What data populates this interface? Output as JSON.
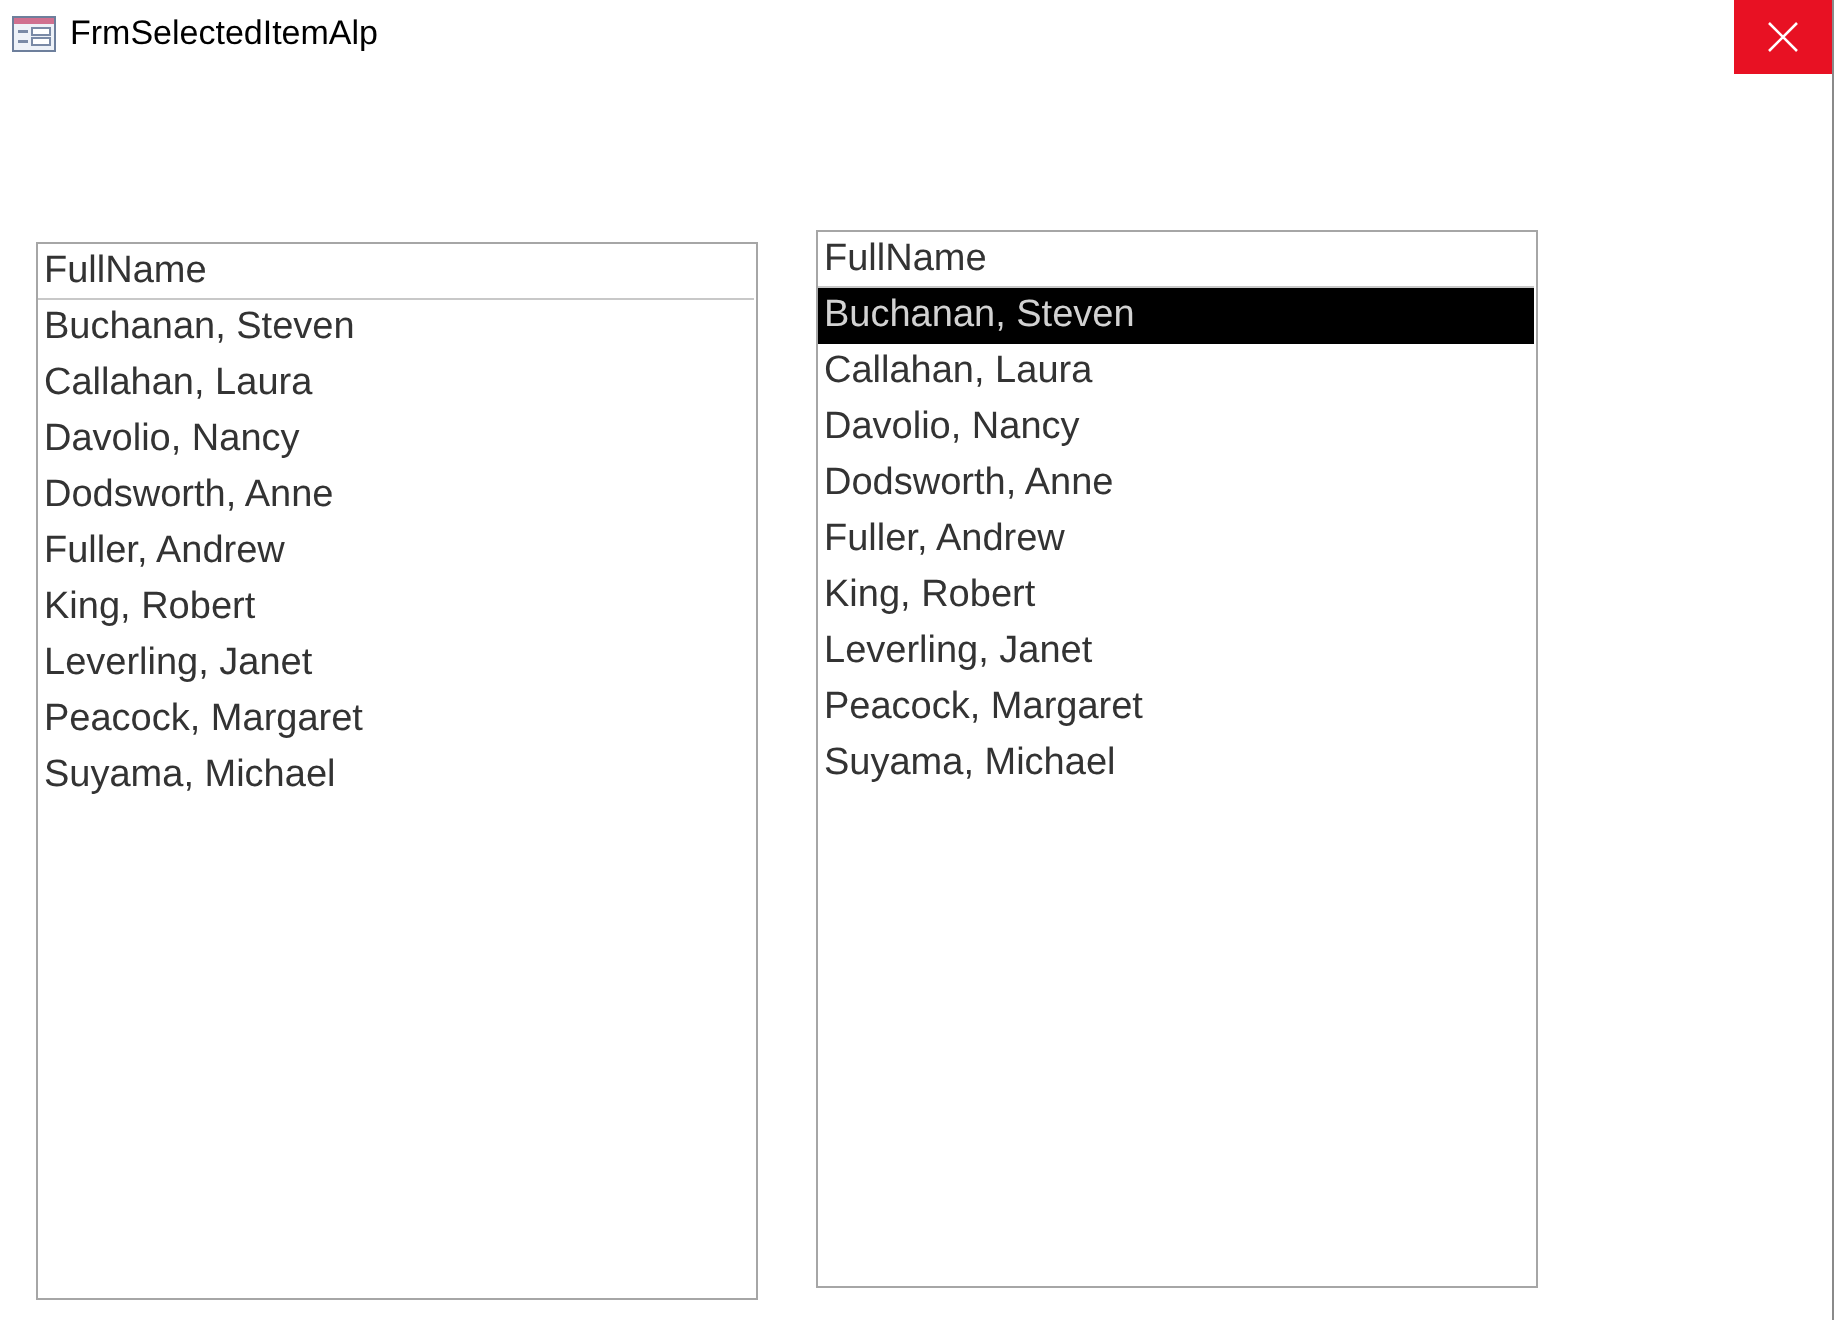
{
  "window": {
    "title": "FrmSelectedItemAlp"
  },
  "lists": [
    {
      "header": "FullName",
      "items": [
        {
          "label": "Buchanan, Steven",
          "selected": false
        },
        {
          "label": "Callahan, Laura",
          "selected": false
        },
        {
          "label": "Davolio, Nancy",
          "selected": false
        },
        {
          "label": "Dodsworth, Anne",
          "selected": false
        },
        {
          "label": "Fuller, Andrew",
          "selected": false
        },
        {
          "label": "King, Robert",
          "selected": false
        },
        {
          "label": "Leverling, Janet",
          "selected": false
        },
        {
          "label": "Peacock, Margaret",
          "selected": false
        },
        {
          "label": "Suyama, Michael",
          "selected": false
        }
      ]
    },
    {
      "header": "FullName",
      "items": [
        {
          "label": "Buchanan, Steven",
          "selected": true
        },
        {
          "label": "Callahan, Laura",
          "selected": false
        },
        {
          "label": "Davolio, Nancy",
          "selected": false
        },
        {
          "label": "Dodsworth, Anne",
          "selected": false
        },
        {
          "label": "Fuller, Andrew",
          "selected": false
        },
        {
          "label": "King, Robert",
          "selected": false
        },
        {
          "label": "Leverling, Janet",
          "selected": false
        },
        {
          "label": "Peacock, Margaret",
          "selected": false
        },
        {
          "label": "Suyama, Michael",
          "selected": false
        }
      ]
    }
  ]
}
